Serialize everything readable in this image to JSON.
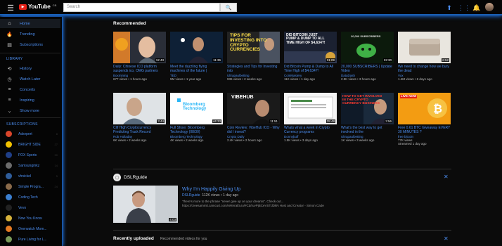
{
  "header": {
    "logo_text": "YouTube",
    "logo_tld": "GB",
    "search_placeholder": "Search"
  },
  "sidebar": {
    "main": [
      {
        "label": "Home",
        "icon": "home-icon"
      },
      {
        "label": "Trending",
        "icon": "flame-icon"
      },
      {
        "label": "Subscriptions",
        "icon": "subscriptions-icon"
      }
    ],
    "library_heading": "LIBRARY",
    "library": [
      {
        "label": "History",
        "icon": "history-icon"
      },
      {
        "label": "Watch Later",
        "icon": "clock-icon"
      },
      {
        "label": "Concerts",
        "icon": "playlist-icon"
      },
      {
        "label": "Inspiring",
        "icon": "playlist-icon"
      },
      {
        "label": "Show more",
        "icon": "chevron-down-icon"
      }
    ],
    "subs_heading": "SUBSCRIPTIONS",
    "subs": [
      {
        "label": "Adsvpert",
        "color": "#d9452b",
        "count": "8"
      },
      {
        "label": "BRIGHT SIDE",
        "color": "#f2c200",
        "count": "27"
      },
      {
        "label": "FOX Sports",
        "color": "#1f3f88",
        "count": "30"
      },
      {
        "label": "Samsungmkz",
        "color": "#6b6b6b",
        "count": "14"
      },
      {
        "label": "vhnickel",
        "color": "#2f5d9a",
        "count": "5"
      },
      {
        "label": "Simple Progra...",
        "color": "#8a6a4a",
        "count": "24"
      },
      {
        "label": "Coding Tech",
        "color": "#3b7fd0",
        "count": ""
      },
      {
        "label": "Vevo",
        "color": "#222222",
        "count": ""
      },
      {
        "label": "Now You Know",
        "color": "#d6b23b",
        "count": ""
      },
      {
        "label": "Overwatch Mom...",
        "color": "#e47b22",
        "count": ""
      },
      {
        "label": "Pure Living for L...",
        "color": "#7a9a5a",
        "count": ""
      }
    ]
  },
  "recommended": {
    "title": "Recommended",
    "videos": [
      {
        "title": "Daily: Chinese ICO platform suspends ico, OMG partners",
        "channel": "Boxmining",
        "meta": "677 views • 1 hours ago",
        "duration": "12:43"
      },
      {
        "title": "Meet the dazzling flying machines of the future |",
        "channel": "TED",
        "meta": "5M views • 1 year ago",
        "duration": "11:36"
      },
      {
        "title": "Strategies and Tips for Investing into",
        "channel": "Ultrapaulbetting",
        "meta": "936 views • 2 weeks ago",
        "duration": "",
        "thumb_text": "TIPS FOR INVESTING INTO CRYPTO CURRENCIES"
      },
      {
        "title": "Did Bitcoin Pump & Dump to All Time High of $4,634?!",
        "channel": "CoinMastery",
        "meta": "11K views • 1 day ago",
        "duration": "31:09",
        "thumb_text": "DID BITCOIN JUST PUMP & DUMP TO ALL TIME HIGH OF $4,634?!"
      },
      {
        "title": "20,000 SUBSCRIBERS | Update Video",
        "channel": "DataDash",
        "meta": "2.9K views • 3 hours ago",
        "duration": "22:30",
        "thumb_text": "20,000 SUBSCRIBERS"
      },
      {
        "title": "We need to change how we bury the dead",
        "channel": "Vox",
        "meta": "1.4M views • 6 days ago",
        "duration": "6:52"
      },
      {
        "title": "Clif High Cryptocurrency Predicting Track Record",
        "channel": "Rob Holladay",
        "meta": "6K views • 2 weeks ago",
        "duration": "3:44"
      },
      {
        "title": "Full Show: Bloomberg Technology (08/30)",
        "channel": "Bloomberg Technology",
        "meta": "4K views • 2 weeks ago",
        "duration": "44:33",
        "thumb_text": "Bloomberg Technology"
      },
      {
        "title": "Coin Review: VibeHub ICO - Why did I invest?",
        "channel": "Crypto Daily",
        "meta": "2.4K views • 2 hours ago",
        "duration": "11:51",
        "thumb_text": "VIBEHUB"
      },
      {
        "title": "Whats what a week in Crypto Currency programs",
        "channel": "Donnybuff",
        "meta": "1.5K views • 3 days ago",
        "duration": "35:48"
      },
      {
        "title": "What's the best way to get involved in the",
        "channel": "Ultrapaulbetting",
        "meta": "1K views • 3 weeks ago",
        "duration": "3:56",
        "thumb_text": "HOW TO GET INVOLVED IN THE CRYPTO CURRENCY BUSINESS"
      },
      {
        "title": "Free 0.61 BTC Giveaway EVERY 30 MINUTES ?",
        "channel": "free bitcoin",
        "meta": "77K views",
        "duration": "",
        "badge": "Streamed 1 day ago",
        "thumb_text": "LIVE NOW"
      }
    ]
  },
  "featured": {
    "channel": "DSLRguide",
    "video_title": "Why I'm Happily Giving Up",
    "video_channel": "DSLRguide",
    "views": "112K views • 1 day ago",
    "duration": "4:03",
    "description": "There's more to the phrase \"never give up on your dreams\". Check out... https://creesammit.camcurt.com/referral/a.io/#Cd/ruvPjBCeVSTdDkN Host and Creator - Simon Cade"
  },
  "recently_uploaded": {
    "title": "Recently uploaded",
    "subtitle": "Recommended videos for you"
  },
  "colors": {
    "link": "#4c8ef0",
    "accent_glow": "#1e73e8",
    "background": "#0b0b0b"
  }
}
